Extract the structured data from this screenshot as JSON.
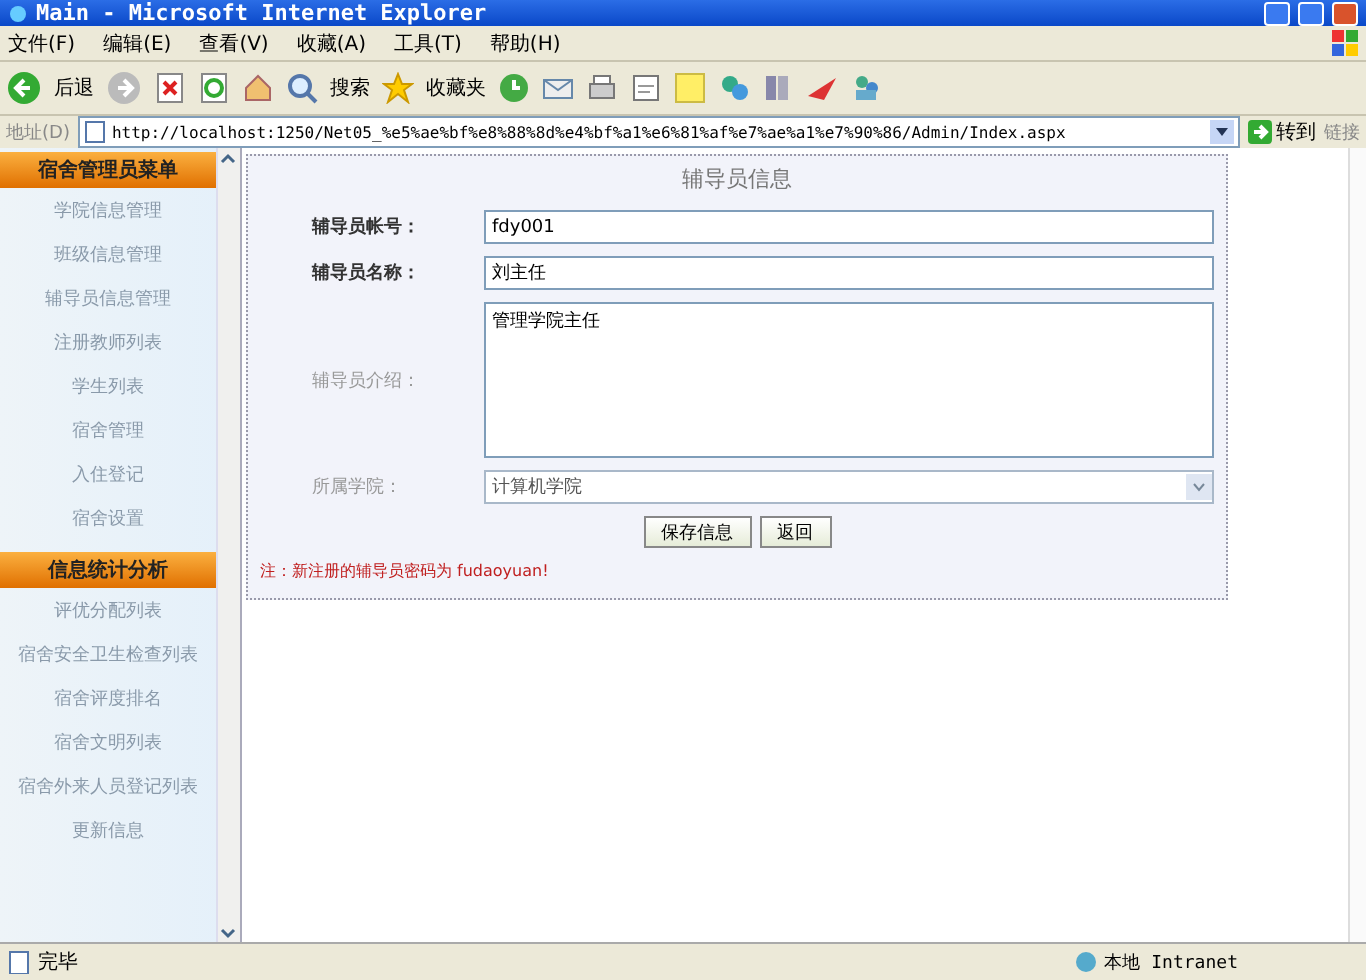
{
  "window": {
    "title": "Main - Microsoft Internet Explorer"
  },
  "menu": [
    "文件(F)",
    "编辑(E)",
    "查看(V)",
    "收藏(A)",
    "工具(T)",
    "帮助(H)"
  ],
  "toolbar": {
    "back": "后退",
    "search": "搜索",
    "favorites": "收藏夹"
  },
  "address_bar": {
    "label": "地址(D)",
    "url": "http://localhost:1250/Net05_%e5%ae%bf%e8%88%8d%e4%bf%a1%e6%81%af%e7%ae%a1%e7%90%86/Admin/Index.aspx",
    "go": "转到",
    "links": "链接"
  },
  "sidebar": [
    {
      "title": "宿舍管理员菜单",
      "items": [
        "学院信息管理",
        "班级信息管理",
        "辅导员信息管理",
        "注册教师列表",
        "学生列表",
        "宿舍管理",
        "入住登记",
        "宿舍设置"
      ]
    },
    {
      "title": "信息统计分析",
      "items": [
        "评优分配列表",
        "宿舍安全卫生检查列表",
        "宿舍评度排名",
        "宿舍文明列表",
        "宿舍外来人员登记列表",
        "更新信息"
      ]
    }
  ],
  "form": {
    "title": "辅导员信息",
    "fields": [
      {
        "kind": "text",
        "label": "辅导员帐号：",
        "value": "fdy001"
      },
      {
        "kind": "text",
        "label": "辅导员名称：",
        "value": "刘主任"
      },
      {
        "kind": "textarea",
        "label": "辅导员介绍：",
        "value": "管理学院主任"
      },
      {
        "kind": "select",
        "label": "所属学院：",
        "value": "计算机学院"
      }
    ],
    "buttons": [
      "保存信息",
      "返回"
    ],
    "note": "注：新注册的辅导员密码为 fudaoyuan!"
  },
  "status_bar": {
    "text": "完毕",
    "zone": "本地 Intranet"
  }
}
